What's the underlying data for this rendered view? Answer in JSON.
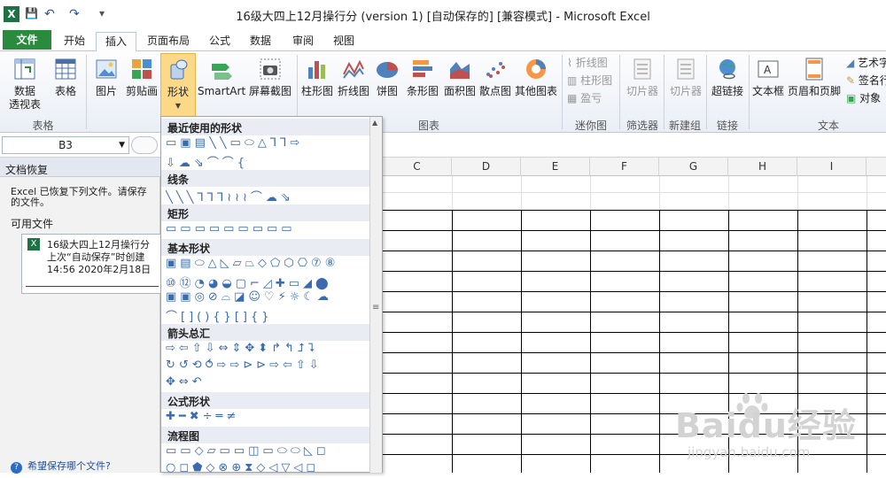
{
  "window": {
    "title": "16级大四上12月操行分 (version 1) [自动保存的]  [兼容模式]  -  Microsoft Excel",
    "qat": [
      "X",
      "💾",
      "↶",
      "↷",
      "▾"
    ]
  },
  "tabs": [
    "文件",
    "开始",
    "插入",
    "页面布局",
    "公式",
    "数据",
    "审阅",
    "视图"
  ],
  "ribbon": {
    "groups": [
      {
        "label": "表格"
      },
      {
        "label": "图表"
      },
      {
        "label": "迷你图"
      },
      {
        "label": "筛选器"
      },
      {
        "label": "新建组"
      },
      {
        "label": "链接"
      },
      {
        "label": "文本"
      }
    ],
    "buttons": {
      "pivot": "数据\n透视表",
      "table": "表格",
      "picture": "图片",
      "clipart": "剪贴画",
      "shapes": "形状",
      "smartart": "SmartArt",
      "screenshot": "屏幕截图",
      "column": "柱形图",
      "line": "折线图",
      "pie": "饼图",
      "bar": "条形图",
      "area": "面积图",
      "scatter": "散点图",
      "other": "其他图表",
      "spark_line": "折线图",
      "spark_col": "柱形图",
      "spark_wl": "盈亏",
      "slicer": "切片器",
      "slicer2": "切片器",
      "hyperlink": "超链接",
      "textbox": "文本框",
      "headerfooter": "页眉和页脚",
      "wordart": "艺术字",
      "signature": "签名行",
      "object": "对象"
    }
  },
  "namebox": {
    "value": "B3"
  },
  "recovery": {
    "title": "文档恢复",
    "desc_line1": "Excel 已恢复下列文件。请保存",
    "desc_line2": "的文件。",
    "available": "可用文件",
    "file_name": "16级大四上12月操行分",
    "file_line2": "上次“自动保存”时创建",
    "file_line3": "14:56 2020年2月18日",
    "help": "希望保存哪个文件?"
  },
  "columns": [
    "C",
    "D",
    "E",
    "F",
    "G",
    "H",
    "I"
  ],
  "shapes": {
    "sections": [
      "最近使用的形状",
      "线条",
      "矩形",
      "基本形状",
      "箭头总汇",
      "公式形状",
      "流程图"
    ],
    "rows": {
      "recent1": "▭▣▤╲╲▭⬭△⅂⅂⇨",
      "recent2": "⇩☁⇘⌒⌒{",
      "lines": "╲╲╲⅂⅂⅂≀≀≀⌒☁⇘",
      "rect": "▭▭▭▭▭▭▭▭▭",
      "basic1": "▣▤⬭△◺▱⏢◇⬠⬡⎔⑦⑧",
      "basic2": "⑩⑫◔◕◒▢⌐◿✚▭◢⬤",
      "basic3": "▣▣◎⊘⌓◪☺♡⚡☼☾☁",
      "basic4": "⌒[](){}[]{}",
      "arrow1": "⇨⇦⇧⇩⇔⇕✥⬍↱↰⮥⮧",
      "arrow2": "↻↺⟲⥀⇨⇨⊳⊳⇨⇦⇧⇩",
      "arrow3": "✥⇔↶",
      "formula": "✚━✖÷═≠",
      "flow1": "▭▭◇▱▭▭◫▭⬭⬭◺◻",
      "flow2": "○◻⬟◇⊗⊕⧗◇◁▽◁◻"
    }
  },
  "watermark": {
    "text": "Baidu经验",
    "url": "jingyan.baidu.com"
  }
}
